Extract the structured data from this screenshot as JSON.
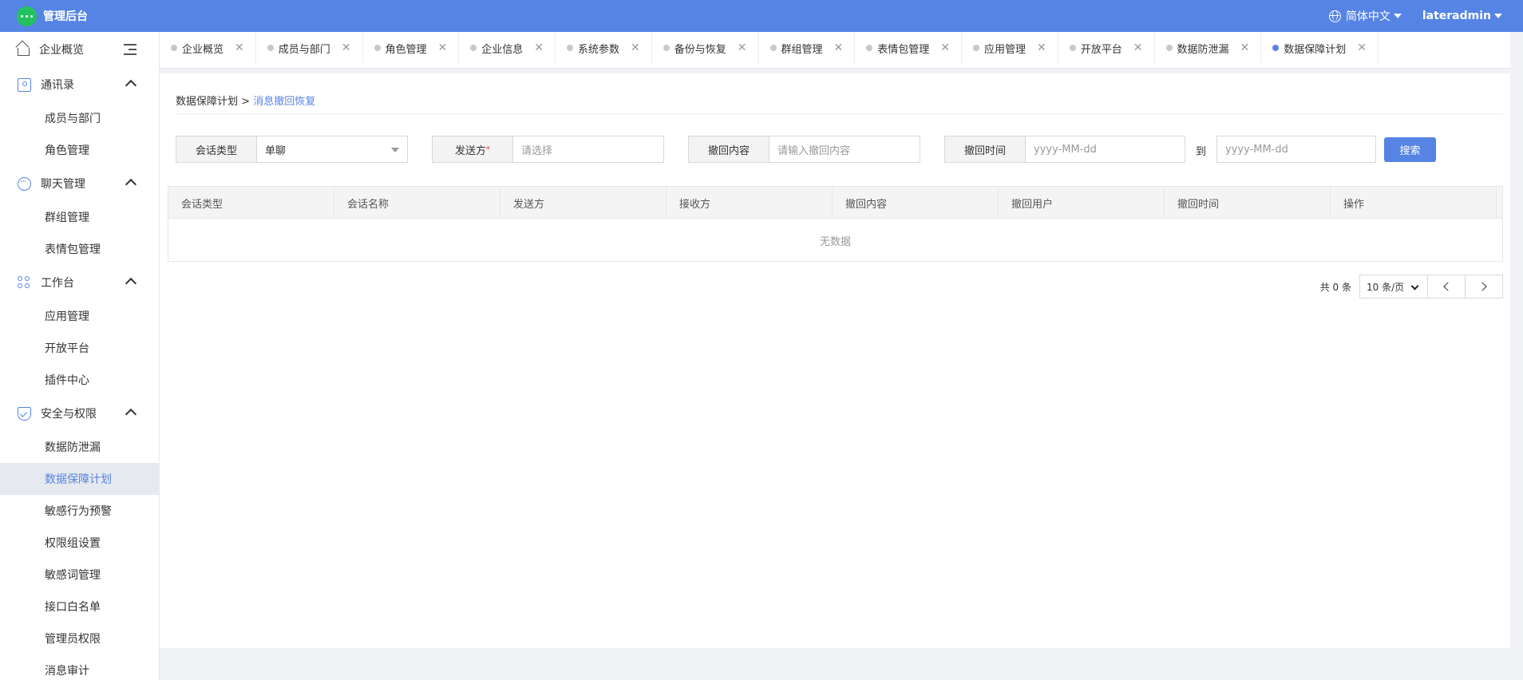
{
  "header": {
    "app_title": "管理后台",
    "language": "简体中文",
    "username": "lateradmin"
  },
  "sidebar": {
    "top": "企业概览",
    "sections": [
      {
        "label": "通讯录",
        "icon": "contacts-icon",
        "items": [
          "成员与部门",
          "角色管理"
        ]
      },
      {
        "label": "聊天管理",
        "icon": "chat-icon",
        "items": [
          "群组管理",
          "表情包管理"
        ]
      },
      {
        "label": "工作台",
        "icon": "workbench-icon",
        "items": [
          "应用管理",
          "开放平台",
          "插件中心"
        ]
      },
      {
        "label": "安全与权限",
        "icon": "shield-icon",
        "items": [
          "数据防泄漏",
          "数据保障计划",
          "敏感行为预警",
          "权限组设置",
          "敏感词管理",
          "接口白名单",
          "管理员权限",
          "消息审计"
        ]
      }
    ],
    "active_item": "数据保障计划"
  },
  "tabs": [
    "企业概览",
    "成员与部门",
    "角色管理",
    "企业信息",
    "系统参数",
    "备份与恢复",
    "群组管理",
    "表情包管理",
    "应用管理",
    "开放平台",
    "数据防泄漏",
    "数据保障计划"
  ],
  "active_tab": "数据保障计划",
  "breadcrumb": {
    "parent": "数据保障计划",
    "separator": ">",
    "current": "消息撤回恢复"
  },
  "filters": {
    "session_type_label": "会话类型",
    "session_type_value": "单聊",
    "sender_label": "发送方",
    "sender_required": "*",
    "sender_placeholder": "请选择",
    "recall_content_label": "撤回内容",
    "recall_content_placeholder": "请输入撤回内容",
    "recall_time_label": "撤回时间",
    "date_start_placeholder": "yyyy-MM-dd",
    "to_label": "到",
    "date_end_placeholder": "yyyy-MM-dd",
    "search_button": "搜索"
  },
  "table": {
    "columns": [
      "会话类型",
      "会话名称",
      "发送方",
      "接收方",
      "撤回内容",
      "撤回用户",
      "撤回时间",
      "操作"
    ],
    "empty_text": "无数据"
  },
  "pagination": {
    "total": "共 0 条",
    "page_size": "10 条/页"
  }
}
